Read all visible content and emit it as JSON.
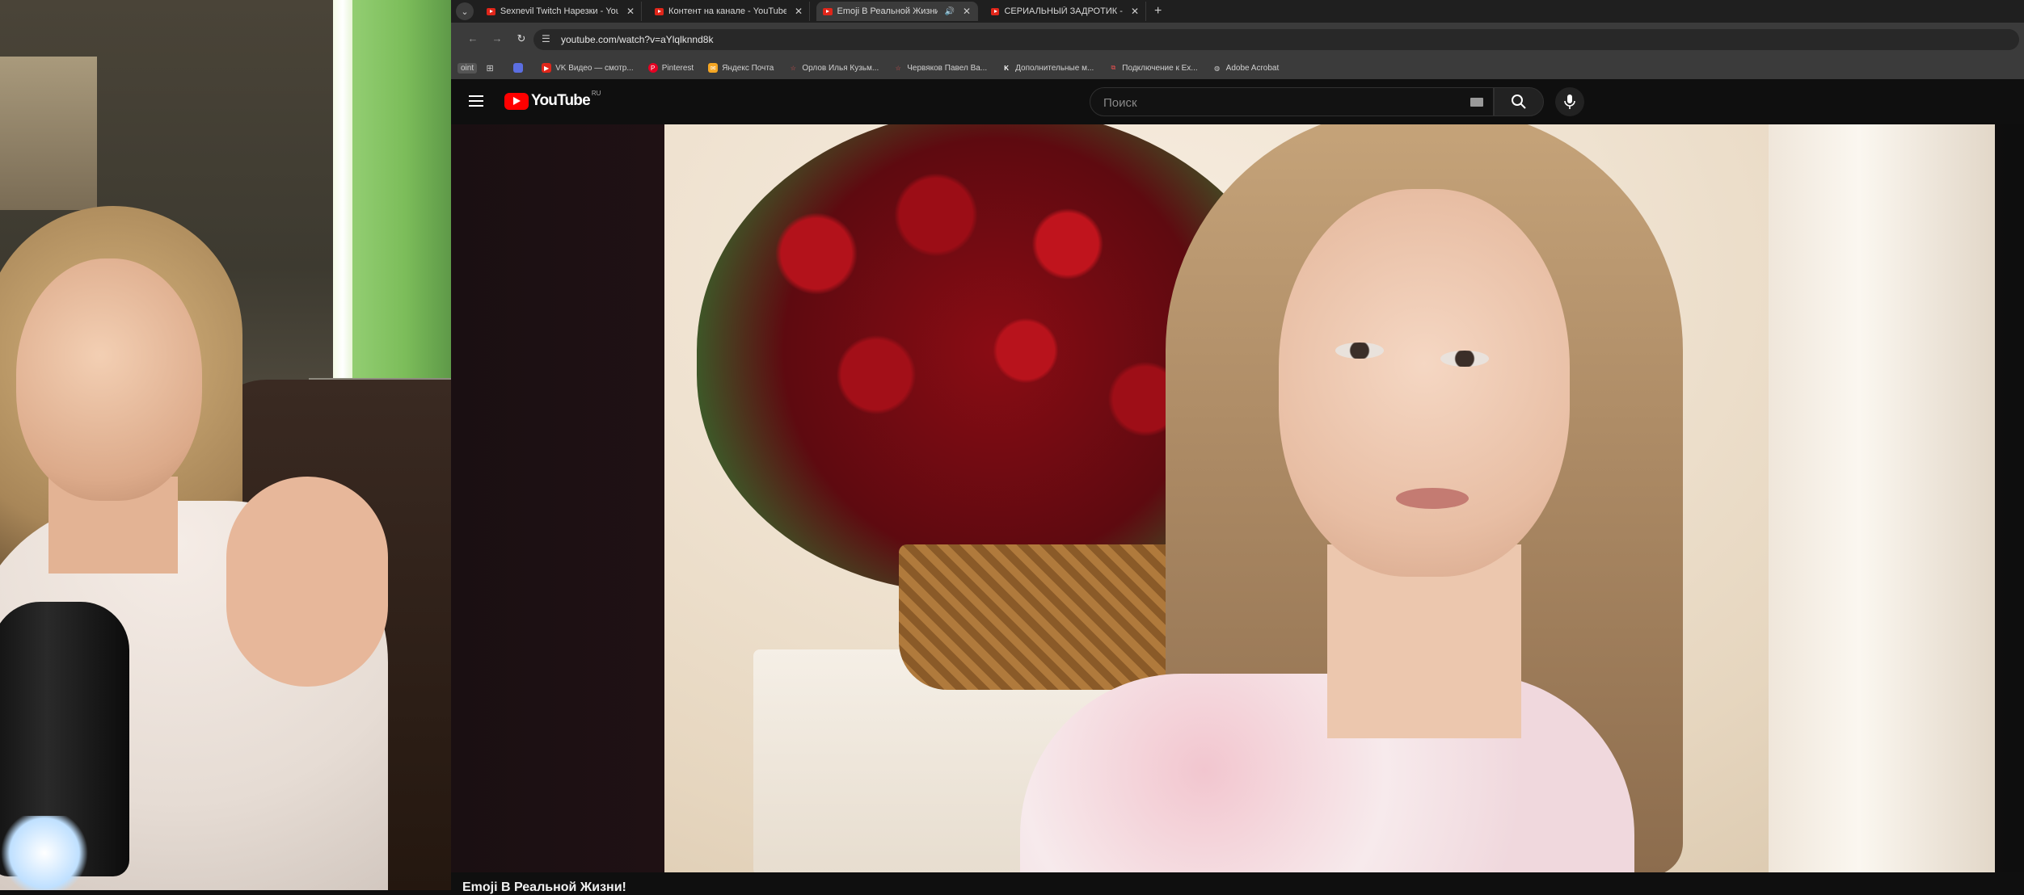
{
  "browser": {
    "tabs": [
      {
        "title": "Sexnevil Twitch Нарезки - YouTu",
        "active": false,
        "audio": false
      },
      {
        "title": "Контент на канале - YouTube S",
        "active": false,
        "audio": false
      },
      {
        "title": "Emoji В Реальной Жизни!",
        "active": true,
        "audio": true
      },
      {
        "title": "СЕРИАЛЬНЫЙ ЗАДРОТИК - You",
        "active": false,
        "audio": false
      }
    ],
    "url": "youtube.com/watch?v=aYlqlknnd8k",
    "bookmarks": [
      {
        "label": "oint",
        "icon": "app-icon"
      },
      {
        "label": "",
        "icon": "grid-icon"
      },
      {
        "label": "",
        "icon": "bookmark-icon"
      },
      {
        "label": "VK Видео — смотр...",
        "icon": "vk-video-icon"
      },
      {
        "label": "Pinterest",
        "icon": "pinterest-icon"
      },
      {
        "label": "Яндекс Почта",
        "icon": "mail-icon"
      },
      {
        "label": "Орлов Илья Кузьм...",
        "icon": "star-icon"
      },
      {
        "label": "Червяков Павел Ва...",
        "icon": "star-icon"
      },
      {
        "label": "Дополнительные м...",
        "icon": "k-icon"
      },
      {
        "label": "Подключение к Ex...",
        "icon": "link-icon"
      },
      {
        "label": "Adobe Acrobat",
        "icon": "globe-icon"
      }
    ]
  },
  "youtube": {
    "logo_text": "YouTube",
    "country_code": "RU",
    "search_placeholder": "Поиск",
    "video_title": "Emoji В Реальной Жизни!"
  },
  "colors": {
    "youtube_red": "#ff0000",
    "background": "#0f0f0f"
  }
}
